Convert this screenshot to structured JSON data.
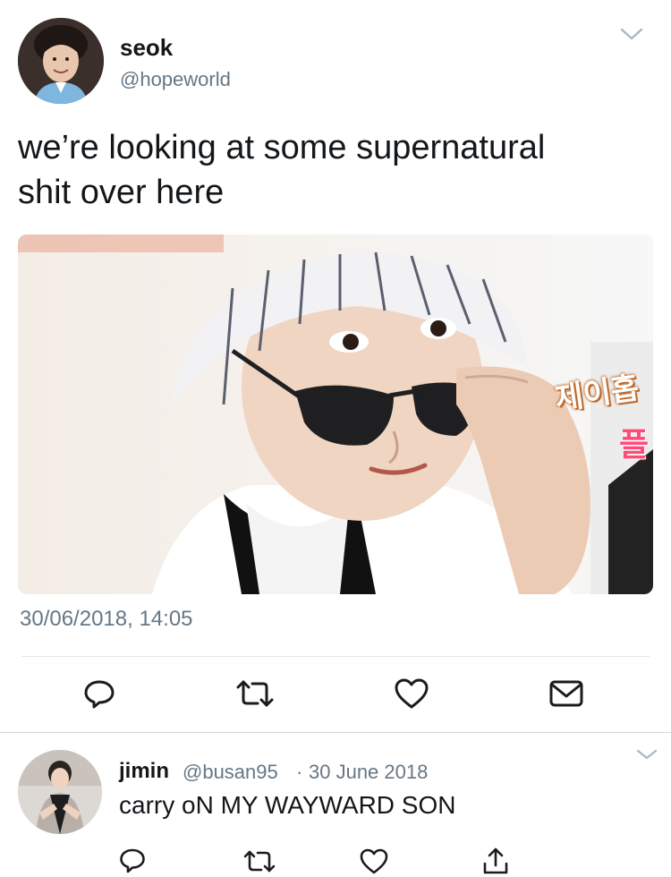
{
  "tweet": {
    "author": {
      "display_name": "seok",
      "handle": "@hopeworld"
    },
    "text_line1": "we’re looking at some supernatural",
    "text_line2": "shit over here",
    "media": {
      "overlay_text_top": "제이홉",
      "overlay_text_bottom": "플"
    },
    "timestamp": "30/06/2018, 14:05",
    "actions": [
      {
        "icon": "reply-icon"
      },
      {
        "icon": "retweet-icon"
      },
      {
        "icon": "like-icon"
      },
      {
        "icon": "message-icon"
      }
    ]
  },
  "reply": {
    "author": {
      "display_name": "jimin",
      "handle": "@busan95"
    },
    "separator": "·",
    "date": "30 June 2018",
    "text": "carry oN MY WAYWARD SON",
    "actions": [
      {
        "icon": "reply-icon"
      },
      {
        "icon": "retweet-icon"
      },
      {
        "icon": "like-icon"
      },
      {
        "icon": "share-icon"
      }
    ]
  },
  "colors": {
    "text": "#14171a",
    "muted": "#657786",
    "icon": "#1c1c1c",
    "divider": "#e1e8ed"
  }
}
